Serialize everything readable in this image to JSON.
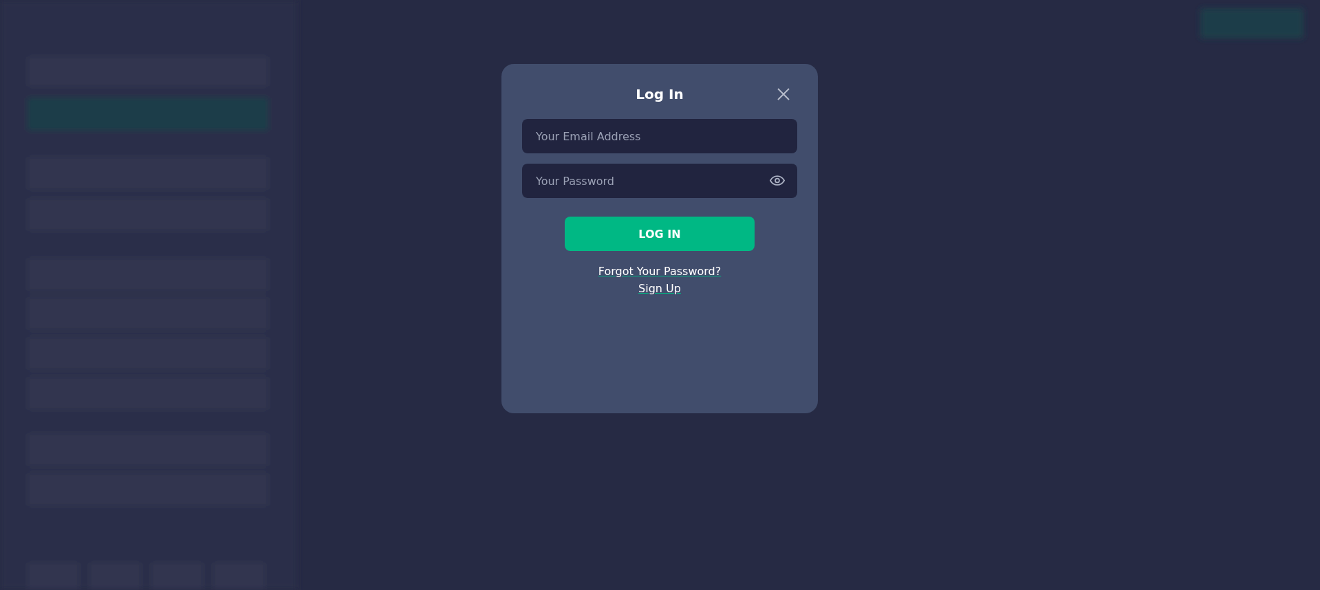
{
  "dialog": {
    "title": "Log In",
    "fields": [
      {
        "kind": "email",
        "placeholder": "Your Email Address"
      },
      {
        "kind": "password",
        "placeholder": "Your Password"
      }
    ],
    "submit": "LOG IN",
    "links": [
      "Forgot Your Password?",
      "Sign Up"
    ]
  }
}
